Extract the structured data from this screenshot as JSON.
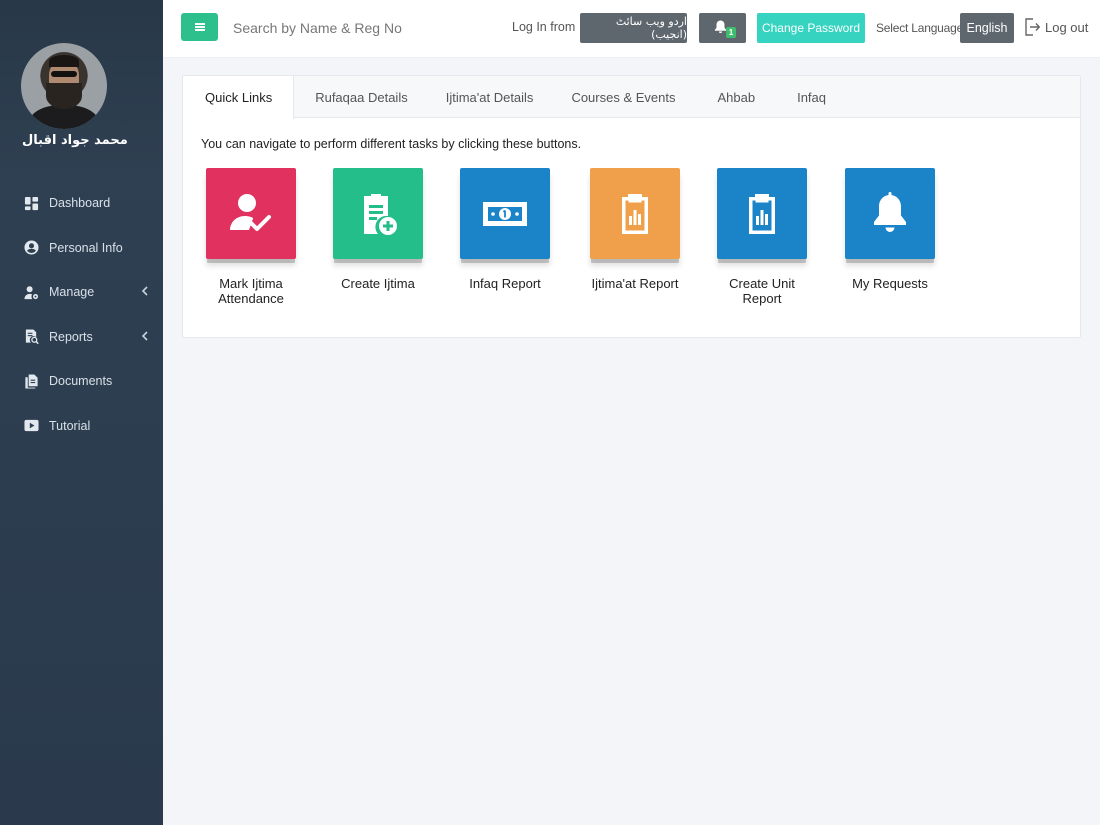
{
  "sidebar": {
    "user_name": "محمد جواد اقبال",
    "items": [
      {
        "label": "Dashboard",
        "icon": "dashboard-icon"
      },
      {
        "label": "Personal Info",
        "icon": "user-circle-icon"
      },
      {
        "label": "Manage",
        "icon": "user-cog-icon",
        "chevron": true
      },
      {
        "label": "Reports",
        "icon": "report-search-icon",
        "chevron": true
      },
      {
        "label": "Documents",
        "icon": "documents-icon"
      },
      {
        "label": "Tutorial",
        "icon": "play-icon"
      }
    ]
  },
  "header": {
    "search_placeholder": "Search by Name & Reg No",
    "login_from_label": "Log In from",
    "urdu_button": "اردو ویب سائٹ (انجیب)",
    "notification_count": "1",
    "change_password": "Change Password",
    "select_language_label": "Select Language",
    "language": "English",
    "logout": "Log out"
  },
  "tabs": [
    {
      "label": "Quick Links",
      "active": true
    },
    {
      "label": "Rufaqaa Details"
    },
    {
      "label": "Ijtima'at Details"
    },
    {
      "label": "Courses & Events"
    },
    {
      "label": "Ahbab"
    },
    {
      "label": "Infaq"
    }
  ],
  "content": {
    "intro": "You can navigate to perform different tasks by clicking these buttons.",
    "tiles": [
      {
        "label": "Mark Ijtima Attendance",
        "color": "#e0315f",
        "icon": "user-check-icon"
      },
      {
        "label": "Create Ijtima",
        "color": "#24be8a",
        "icon": "clipboard-plus-icon"
      },
      {
        "label": "Infaq Report",
        "color": "#1b84c9",
        "icon": "banknote-icon"
      },
      {
        "label": "Ijtima'at Report",
        "color": "#f0a04a",
        "icon": "clipboard-chart-icon"
      },
      {
        "label": "Create Unit Report",
        "color": "#1b84c9",
        "icon": "clipboard-chart-icon"
      },
      {
        "label": "My Requests",
        "color": "#1b84c9",
        "icon": "bell-icon"
      }
    ]
  },
  "colors": {
    "sidebar_bg": "#2f4154",
    "accent_green": "#2ec08c",
    "accent_teal": "#35d3c0",
    "button_gray": "#5e666e"
  }
}
